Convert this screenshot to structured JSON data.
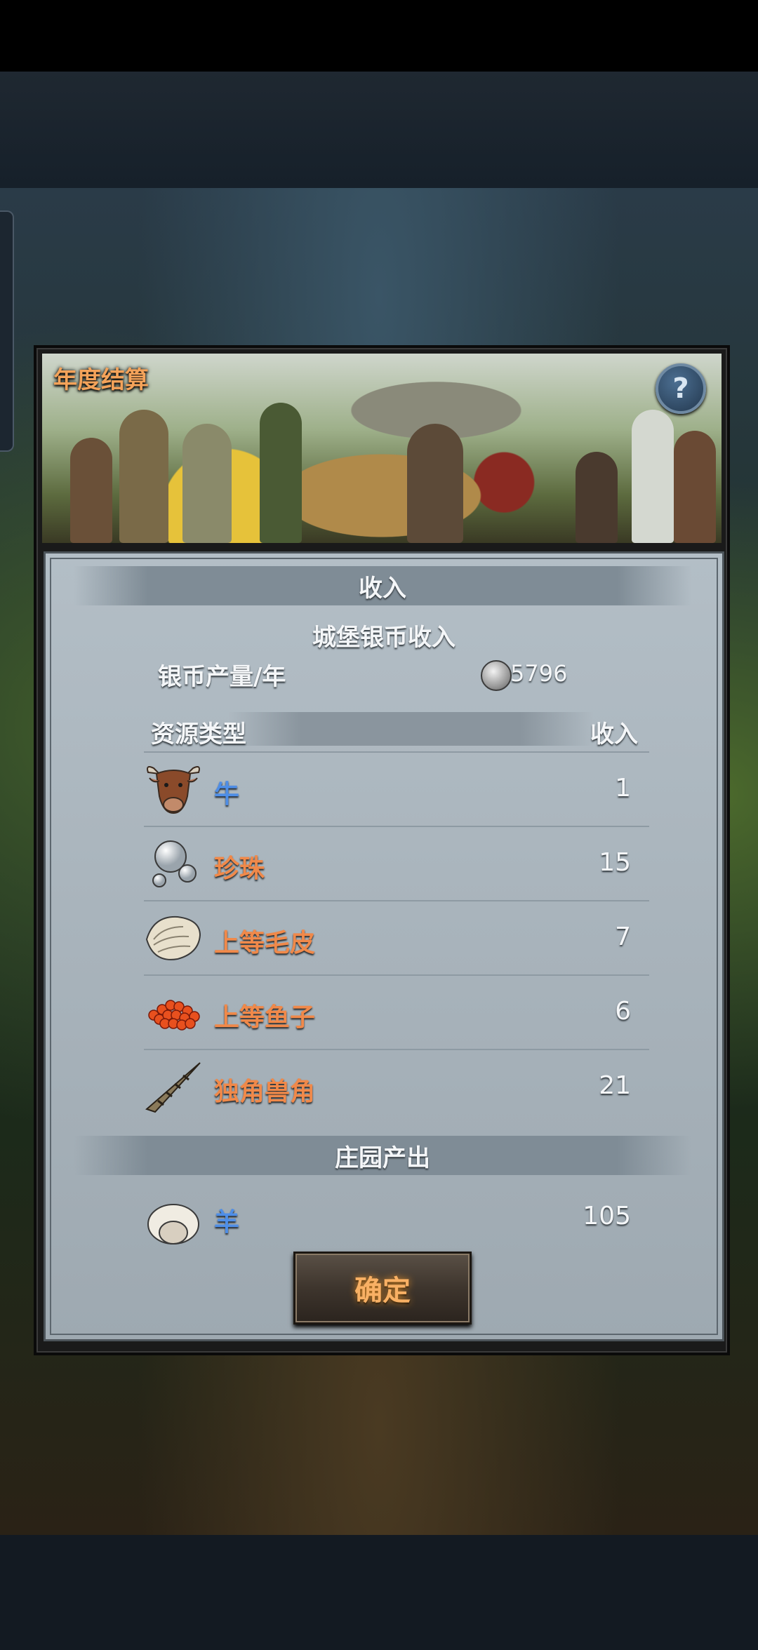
{
  "dialog": {
    "title": "年度结算",
    "help_label": "?"
  },
  "income": {
    "header": "收入",
    "castle_header": "城堡银币收入",
    "silver_label": "银币产量/年",
    "silver_value": "5796",
    "col_type": "资源类型",
    "col_income": "收入",
    "items": [
      {
        "name": "牛",
        "qty": "1",
        "icon": "cow-icon",
        "color": "#4f8ee6"
      },
      {
        "name": "珍珠",
        "qty": "15",
        "icon": "pearl-icon",
        "color": "#f0894a"
      },
      {
        "name": "上等毛皮",
        "qty": "7",
        "icon": "fur-icon",
        "color": "#f0894a"
      },
      {
        "name": "上等鱼子",
        "qty": "6",
        "icon": "roe-icon",
        "color": "#f0894a"
      },
      {
        "name": "独角兽角",
        "qty": "21",
        "icon": "unicorn-horn-icon",
        "color": "#f0894a"
      }
    ]
  },
  "estate": {
    "header": "庄园产出",
    "items": [
      {
        "name": "羊",
        "qty": "105",
        "icon": "sheep-icon",
        "color": "#4f8ee6"
      }
    ]
  },
  "confirm_label": "确定"
}
